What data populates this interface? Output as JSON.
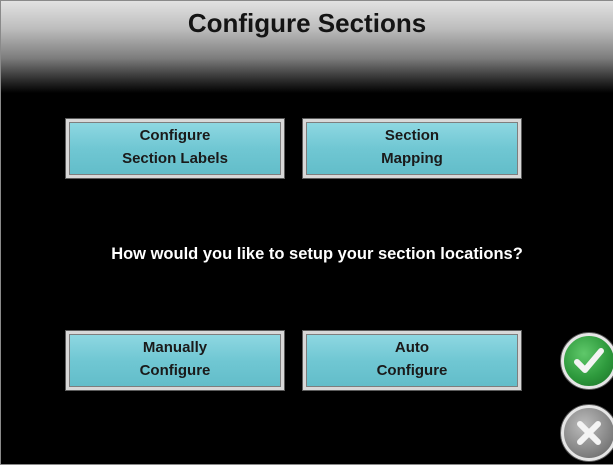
{
  "header": {
    "title": "Configure Sections"
  },
  "buttons": {
    "section_labels": {
      "line1": "Configure",
      "line2": "Section Labels"
    },
    "section_mapping": {
      "line1": "Section",
      "line2": "Mapping"
    },
    "manual_configure": {
      "line1": "Manually",
      "line2": "Configure"
    },
    "auto_configure": {
      "line1": "Auto",
      "line2": "Configure"
    }
  },
  "prompt": {
    "question": "How would you like to setup your section locations?"
  },
  "actions": {
    "accept_icon": "checkmark-icon",
    "cancel_icon": "close-icon"
  },
  "colors": {
    "button_fill": "#70c7d3",
    "accept": "#2e9a3d",
    "cancel": "#8a8a8a",
    "background": "#000000"
  }
}
